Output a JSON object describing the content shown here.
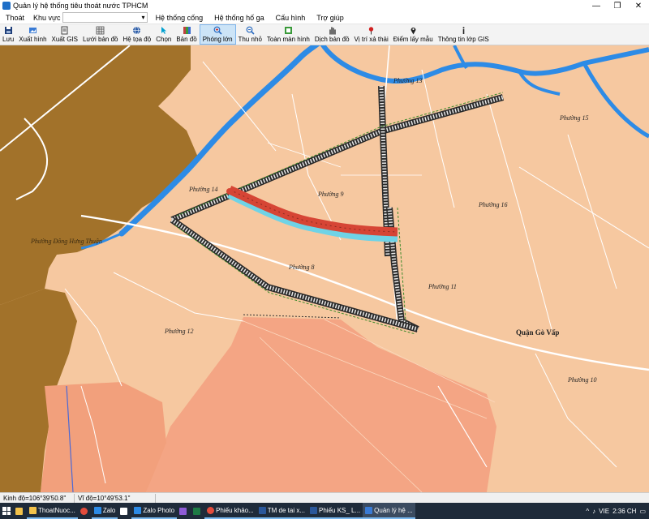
{
  "window": {
    "title": "Quản lý hệ thống tiêu thoát nước TPHCM",
    "controls": [
      "—",
      "❐",
      "✕"
    ]
  },
  "menu": {
    "exit": "Thoát",
    "area_label": "Khu vực",
    "area_value": "",
    "items": [
      "Hệ thống cống",
      "Hệ thống hố ga",
      "Cấu hình",
      "Trợ giúp"
    ]
  },
  "toolbar": {
    "items": [
      {
        "label": "Lưu",
        "icon": "save-icon",
        "color": "#1f3f7a"
      },
      {
        "label": "Xuất hình",
        "icon": "export-image-icon",
        "color": "#3a7bd5"
      },
      {
        "label": "Xuất GIS",
        "icon": "export-gis-icon",
        "color": "#444444"
      },
      {
        "label": "Lưới bản đồ",
        "icon": "map-grid-icon",
        "color": "#444444"
      },
      {
        "label": "Hệ tọa độ",
        "icon": "globe-icon",
        "color": "#2e5ea8"
      },
      {
        "label": "Chọn",
        "icon": "select-cursor-icon",
        "color": "#00a0d0"
      },
      {
        "label": "Bản đồ",
        "icon": "layers-icon",
        "color": "#c04040"
      },
      {
        "label": "Phóng lớn",
        "icon": "zoom-in-icon",
        "color": "#2a6bc1",
        "active": true
      },
      {
        "label": "Thu nhỏ",
        "icon": "zoom-out-icon",
        "color": "#2a6bc1"
      },
      {
        "label": "Toàn màn hình",
        "icon": "full-extent-icon",
        "color": "#3a9a3a"
      },
      {
        "label": "Dịch bản đồ",
        "icon": "pan-icon",
        "color": "#333333"
      },
      {
        "label": "Vị trí xả thải",
        "icon": "discharge-pin-icon",
        "color": "#d02020"
      },
      {
        "label": "Điểm lấy mẫu",
        "icon": "sample-pin-icon",
        "color": "#222222"
      },
      {
        "label": "Thông tin lớp GIS",
        "icon": "info-icon",
        "color": "#222222"
      }
    ]
  },
  "map": {
    "labels": {
      "phuong13": "Phường 13",
      "phuong15": "Phường 15",
      "phuong14": "Phường 14",
      "phuong9": "Phường 9",
      "phuong16": "Phường 16",
      "phuong8": "Phường 8",
      "phuong11": "Phường 11",
      "phuong12": "Phường 12",
      "phuong10": "Phường 10",
      "dongthuan": "Phường Đông Hưng Thuận",
      "govap": "Quận Gò Vấp"
    },
    "colors": {
      "residential": "#f6c8a0",
      "green_zone": "#a2722a",
      "river": "#2d8be6",
      "airport": "#f4a584",
      "airport_block": "#f2a07c",
      "selected_segment": "#d64535",
      "pipe_outline": "#2a2a2a",
      "roads": "#ffffff"
    }
  },
  "status": {
    "longitude": "Kinh độ=106°39'50.8''",
    "latitude": "Vĩ độ=10°49'53.1''"
  },
  "taskbar": {
    "items": [
      {
        "label": "",
        "icon": "explorer-icon",
        "color": "#f3c24a"
      },
      {
        "label": "ThoatNuoc...",
        "icon": "folder-icon",
        "color": "#f3c24a"
      },
      {
        "label": "",
        "icon": "chrome-icon",
        "color": "#e44c3c"
      },
      {
        "label": "Zalo",
        "icon": "zalo-icon",
        "color": "#2d8be6"
      },
      {
        "label": "",
        "icon": "app-icon",
        "color": "#ffffff"
      },
      {
        "label": "Zalo Photo",
        "icon": "zalo-photo-icon",
        "color": "#2d8be6"
      },
      {
        "label": "",
        "icon": "visual-studio-icon",
        "color": "#8e5bd6"
      },
      {
        "label": "",
        "icon": "excel-icon",
        "color": "#1e7b45"
      },
      {
        "label": "Phiếu khảo...",
        "icon": "chrome-icon",
        "color": "#e44c3c"
      },
      {
        "label": "TM de tai x...",
        "icon": "word-icon",
        "color": "#2b579a"
      },
      {
        "label": "Phiếu KS_ L...",
        "icon": "word-icon",
        "color": "#2b579a"
      },
      {
        "label": "Quản lý hệ ...",
        "icon": "app-icon",
        "color": "#3a7bd5"
      }
    ],
    "tray": {
      "language": "VIE",
      "time": "2:36 CH"
    }
  }
}
